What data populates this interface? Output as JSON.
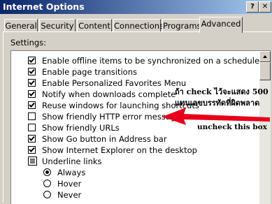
{
  "window": {
    "title": "Internet Options",
    "help_glyph": "?",
    "close_glyph": "✕"
  },
  "tabs": [
    {
      "label": "General"
    },
    {
      "label": "Security"
    },
    {
      "label": "Content"
    },
    {
      "label": "Connections"
    },
    {
      "label": "Programs"
    },
    {
      "label": "Advanced",
      "active": true
    }
  ],
  "settings": {
    "label": "Settings:",
    "items": [
      {
        "label": "Enable offline items to be synchronized on a schedule",
        "checked": true
      },
      {
        "label": "Enable page transitions",
        "checked": true
      },
      {
        "label": "Enable Personalized Favorites Menu",
        "checked": true
      },
      {
        "label": "Notify when downloads complete",
        "checked": true
      },
      {
        "label": "Reuse windows for launching shortcuts",
        "checked": true
      },
      {
        "label": "Show friendly HTTP error messages",
        "checked": false
      },
      {
        "label": "Show friendly URLs",
        "checked": false
      },
      {
        "label": "Show Go button in Address bar",
        "checked": true
      },
      {
        "label": "Show Internet Explorer on the desktop",
        "checked": true
      }
    ],
    "group": {
      "label": "Underline links",
      "icon": "list-settings-icon"
    },
    "radios": [
      {
        "label": "Always",
        "selected": true
      },
      {
        "label": "Hover",
        "selected": false
      },
      {
        "label": "Never",
        "selected": false
      }
    ]
  },
  "annotations": {
    "thai_line1": "ถ้า check ไว้จะแสดง 500",
    "thai_line2": "แทนเลขบรรทัดที่ผิดพลาด",
    "uncheck_note": "uncheck this box",
    "arrow_color": "#e8001a"
  }
}
